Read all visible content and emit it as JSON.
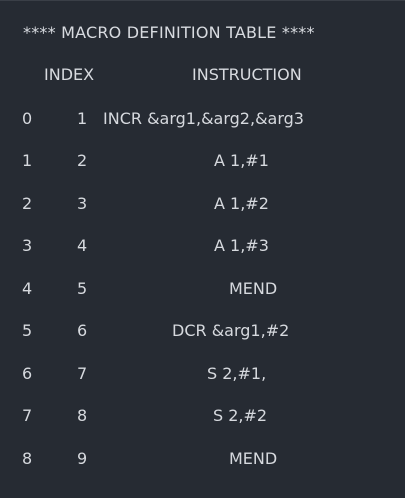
{
  "title": "**** MACRO DEFINITION TABLE ****",
  "columns": {
    "index": "INDEX",
    "instruction": "INSTRUCTION"
  },
  "rows": [
    {
      "row": "0",
      "index": "1",
      "instruction": "INCR &arg1,&arg2,&arg3"
    },
    {
      "row": "1",
      "index": "2",
      "instruction": "A 1,#1"
    },
    {
      "row": "2",
      "index": "3",
      "instruction": "A 1,#2"
    },
    {
      "row": "3",
      "index": "4",
      "instruction": "A 1,#3"
    },
    {
      "row": "4",
      "index": "5",
      "instruction": "MEND"
    },
    {
      "row": "5",
      "index": "6",
      "instruction": "DCR &arg1,#2"
    },
    {
      "row": "6",
      "index": "7",
      "instruction": "S 2,#1,"
    },
    {
      "row": "7",
      "index": "8",
      "instruction": "S 2,#2"
    },
    {
      "row": "8",
      "index": "9",
      "instruction": "MEND"
    }
  ]
}
